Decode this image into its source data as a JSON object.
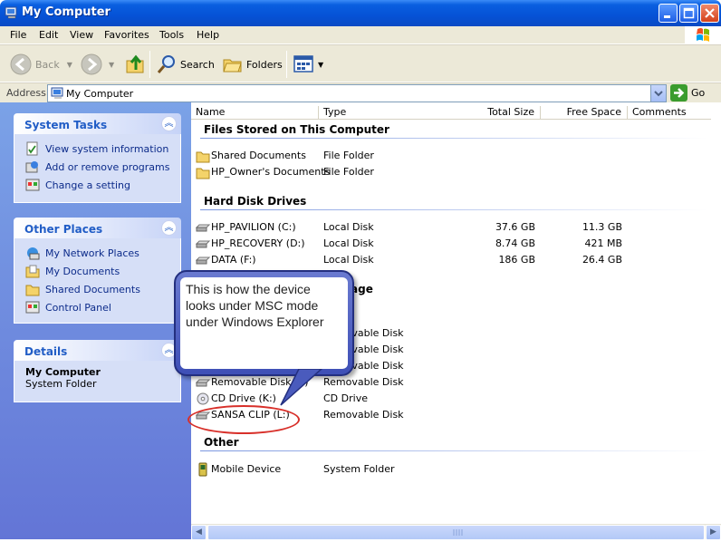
{
  "window": {
    "title": "My Computer"
  },
  "menu": [
    "File",
    "Edit",
    "View",
    "Favorites",
    "Tools",
    "Help"
  ],
  "toolbar": {
    "back": "Back",
    "search": "Search",
    "folders": "Folders"
  },
  "address": {
    "label": "Address",
    "value": "My Computer",
    "go": "Go"
  },
  "left_panel": {
    "system_tasks": {
      "title": "System Tasks",
      "items": [
        "View system information",
        "Add or remove programs",
        "Change a setting"
      ]
    },
    "other_places": {
      "title": "Other Places",
      "items": [
        "My Network Places",
        "My Documents",
        "Shared Documents",
        "Control Panel"
      ]
    },
    "details": {
      "title": "Details",
      "name": "My Computer",
      "kind": "System Folder"
    }
  },
  "columns": {
    "name": "Name",
    "type": "Type",
    "total_size": "Total Size",
    "free_space": "Free Space",
    "comments": "Comments"
  },
  "groups": {
    "files_stored": {
      "title": "Files Stored on This Computer",
      "rows": [
        {
          "name": "Shared Documents",
          "type": "File Folder",
          "total": "",
          "free": ""
        },
        {
          "name": "HP_Owner's Documents",
          "type": "File Folder",
          "total": "",
          "free": ""
        }
      ]
    },
    "hard_disks": {
      "title": "Hard Disk Drives",
      "rows": [
        {
          "name": "HP_PAVILION (C:)",
          "type": "Local Disk",
          "total": "37.6 GB",
          "free": "11.3 GB"
        },
        {
          "name": "HP_RECOVERY (D:)",
          "type": "Local Disk",
          "total": "8.74 GB",
          "free": "421 MB"
        },
        {
          "name": "DATA (F:)",
          "type": "Local Disk",
          "total": "186 GB",
          "free": "26.4 GB"
        }
      ]
    },
    "removable": {
      "title_fragment": "age",
      "rows": [
        {
          "name": "",
          "type": "Drive"
        },
        {
          "name": "",
          "type": "Removable Disk"
        },
        {
          "name": "",
          "type": "Removable Disk"
        },
        {
          "name": "",
          "type": "Removable Disk"
        },
        {
          "name": "Removable Disk (J:)",
          "type": "Removable Disk"
        },
        {
          "name": "CD Drive (K:)",
          "type": "CD Drive"
        },
        {
          "name": "SANSA CLIP (L:)",
          "type": "Removable Disk"
        }
      ]
    },
    "other": {
      "title": "Other",
      "rows": [
        {
          "name": "Mobile Device",
          "type": "System Folder"
        }
      ]
    }
  },
  "callout": {
    "text": "This is how the device looks under MSC mode under Windows Explorer"
  }
}
